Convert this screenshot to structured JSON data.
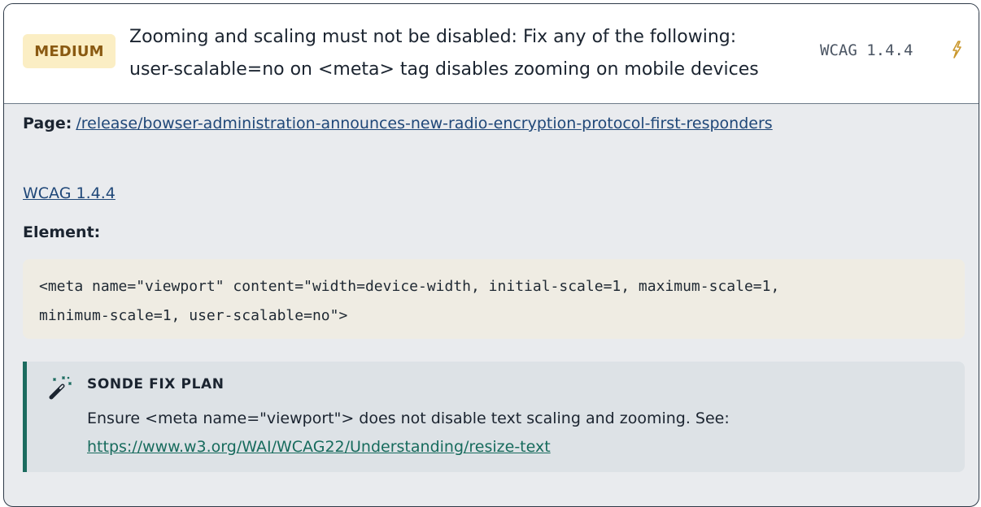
{
  "issue": {
    "severity": "MEDIUM",
    "title_line1": "Zooming and scaling must not be disabled: Fix any of the following:",
    "title_line2": "user-scalable=no on <meta> tag disables zooming on mobile devices",
    "wcag": "WCAG 1.4.4",
    "action_icon": "bolt-icon"
  },
  "details": {
    "page_label": "Page:",
    "page_url": "/release/bowser-administration-announces-new-radio-encryption-protocol-first-responders",
    "wcag_link": "WCAG 1.4.4",
    "element_label": "Element:",
    "element_code": "<meta name=\"viewport\" content=\"width=device-width, initial-scale=1, maximum-scale=1,\nminimum-scale=1, user-scalable=no\">"
  },
  "fix_plan": {
    "icon": "magic-wand-icon",
    "title": "SONDE FIX PLAN",
    "text": "Ensure <meta name=\"viewport\"> does not disable text scaling and zooming. See:",
    "link": "https://www.w3.org/WAI/WCAG22/Understanding/resize-text"
  },
  "colors": {
    "severity_bg": "#fbeec4",
    "severity_text": "#8a5a12",
    "accent_green": "#1b6b5f",
    "link_blue": "#1f4778",
    "panel_bg": "#e9ebee",
    "code_bg": "#efece3",
    "fix_bg": "#dde2e6"
  }
}
